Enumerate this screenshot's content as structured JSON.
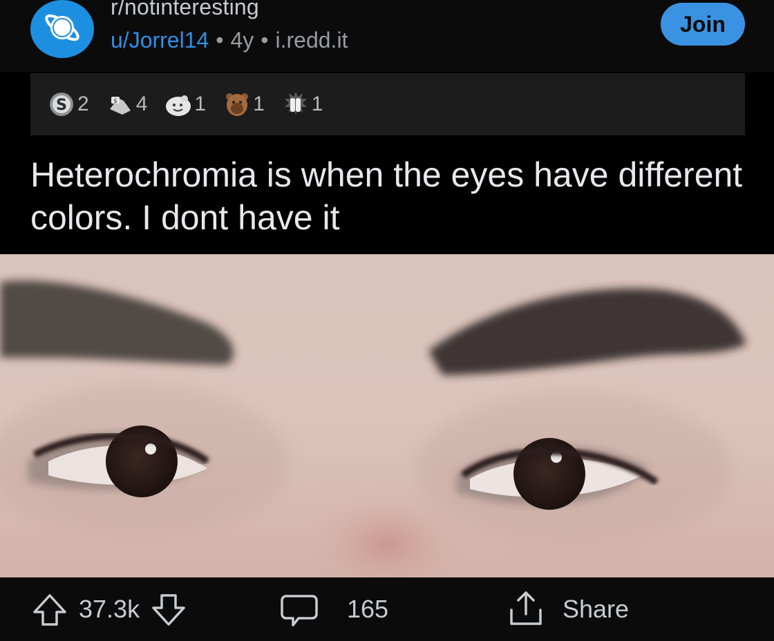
{
  "post": {
    "subreddit": "r/notinteresting",
    "author": "u/Jorrel14",
    "age": "4y",
    "domain": "i.redd.it",
    "join_label": "Join",
    "title": "Heterochromia is when the eyes have different colors. I dont have it"
  },
  "awards": [
    {
      "icon": "silver-award-icon",
      "count": "2"
    },
    {
      "icon": "helpful-hands-award-icon",
      "count": "4"
    },
    {
      "icon": "wholesome-face-award-icon",
      "count": "1"
    },
    {
      "icon": "bear-award-icon",
      "count": "1"
    },
    {
      "icon": "facepalm-award-icon",
      "count": "1"
    }
  ],
  "actions": {
    "upvotes": "37.3k",
    "comments": "165",
    "share_label": "Share"
  },
  "colors": {
    "background": "#000000",
    "accent": "#3b92e3",
    "username": "#2f8fe6",
    "awards_bg": "#1c1c1d"
  }
}
